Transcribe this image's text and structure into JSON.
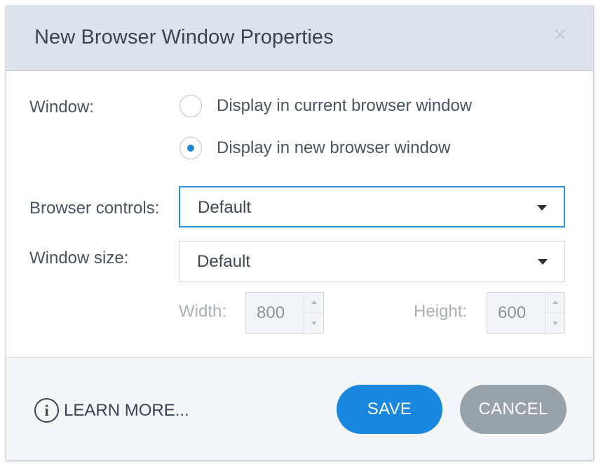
{
  "dialog": {
    "title": "New Browser Window Properties",
    "close_symbol": "×"
  },
  "window_option": {
    "label": "Window:",
    "options": [
      {
        "label": "Display in current browser window",
        "selected": false
      },
      {
        "label": "Display in new browser window",
        "selected": true
      }
    ]
  },
  "browser_controls": {
    "label": "Browser controls:",
    "value": "Default"
  },
  "window_size": {
    "label": "Window size:",
    "value": "Default",
    "width_label": "Width:",
    "width_value": "800",
    "height_label": "Height:",
    "height_value": "600"
  },
  "footer": {
    "learn_more": "LEARN MORE...",
    "save_label": "SAVE",
    "cancel_label": "CANCEL"
  },
  "colors": {
    "accent": "#1a87de",
    "header_bg": "#dce3ea",
    "cancel_bg": "#98a2ab"
  },
  "icons": {
    "close": "close-icon",
    "info": "info-icon",
    "caret": "chevron-down-icon"
  }
}
